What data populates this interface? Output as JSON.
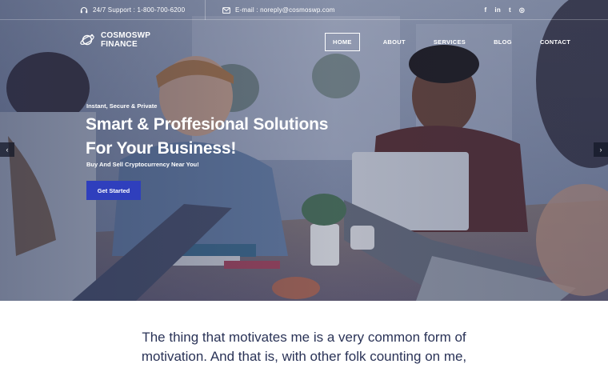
{
  "topbar": {
    "support_text": "24/7 Support : 1-800-700-6200",
    "email_text": "E-mail : noreply@cosmoswp.com",
    "social": [
      {
        "icon": "facebook-icon",
        "glyph": "f"
      },
      {
        "icon": "linkedin-icon",
        "glyph": "in"
      },
      {
        "icon": "twitter-icon",
        "glyph": "t"
      },
      {
        "icon": "instagram-icon",
        "glyph": "◎"
      }
    ]
  },
  "header": {
    "logo_line1": "COSMOSWP",
    "logo_line2": "FINANCE",
    "nav": [
      {
        "label": "HOME",
        "active": true
      },
      {
        "label": "ABOUT",
        "active": false
      },
      {
        "label": "SERVICES",
        "active": false
      },
      {
        "label": "BLOG",
        "active": false
      },
      {
        "label": "CONTACT",
        "active": false
      }
    ]
  },
  "hero": {
    "eyebrow": "Instant, Secure & Private",
    "headline_line1": "Smart & Proffesional Solutions",
    "headline_line2": "For Your Business!",
    "subline": "Buy And Sell Cryptocurrency Near You!",
    "cta_label": "Get Started",
    "arrow_left": "‹",
    "arrow_right": "›"
  },
  "quote": {
    "line1": "The thing that motivates me is a very common form of",
    "line2": "motivation. And that is, with other folk counting on me,"
  },
  "colors": {
    "overlay": "#263256",
    "cta": "#2f3fbd",
    "quote_text": "#2a3357"
  }
}
